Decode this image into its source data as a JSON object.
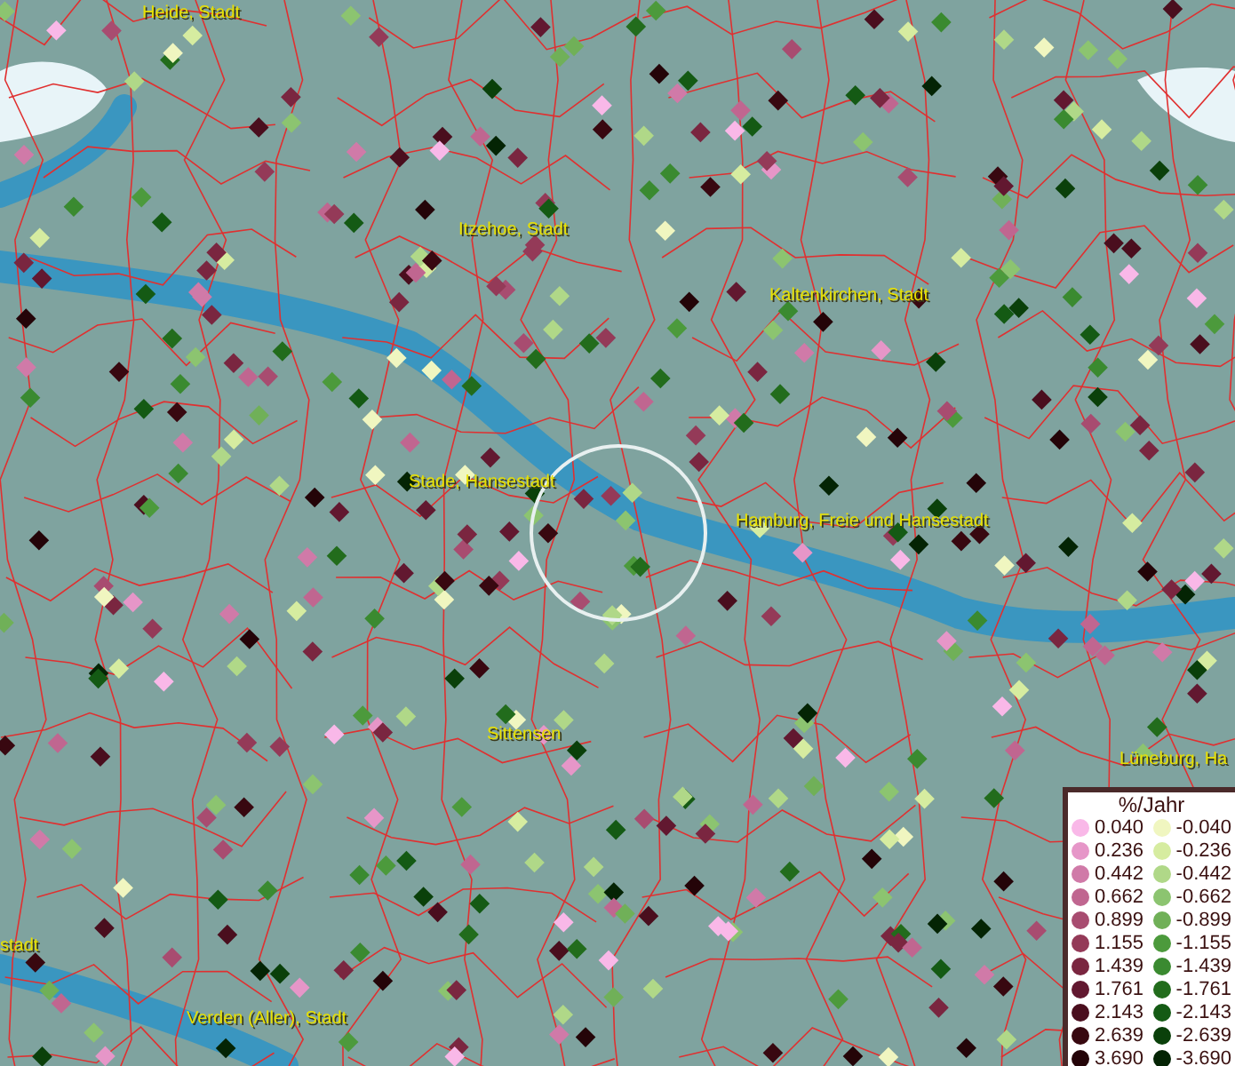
{
  "map_labels": [
    "Heide, Stadt",
    "Itzehoe, Stadt",
    "Kaltenkirchen, Stadt",
    "Stade, Hansestadt",
    "Hamburg, Freie und Hansestadt",
    "Sittensen",
    "Lüneburg, Ha",
    "stadt",
    "Verden (Aller), Stadt"
  ],
  "legend": {
    "title": "%/Jahr",
    "positive": [
      {
        "value": "0.040",
        "color": "#f9b8e8"
      },
      {
        "value": "0.236",
        "color": "#e696c8"
      },
      {
        "value": "0.442",
        "color": "#d07aa8"
      },
      {
        "value": "0.662",
        "color": "#c06690"
      },
      {
        "value": "0.899",
        "color": "#a84c70"
      },
      {
        "value": "1.155",
        "color": "#943a58"
      },
      {
        "value": "1.439",
        "color": "#7a2640"
      },
      {
        "value": "1.761",
        "color": "#621830"
      },
      {
        "value": "2.143",
        "color": "#4a0e1e"
      },
      {
        "value": "2.639",
        "color": "#380810"
      },
      {
        "value": "3.690",
        "color": "#240408"
      }
    ],
    "negative": [
      {
        "value": "-0.040",
        "color": "#f0f6c0"
      },
      {
        "value": "-0.236",
        "color": "#d6eca0"
      },
      {
        "value": "-0.442",
        "color": "#b0d888"
      },
      {
        "value": "-0.662",
        "color": "#8cc470"
      },
      {
        "value": "-0.899",
        "color": "#70b058"
      },
      {
        "value": "-1.155",
        "color": "#4c9a3c"
      },
      {
        "value": "-1.439",
        "color": "#3a8a30"
      },
      {
        "value": "-1.761",
        "color": "#226c1c"
      },
      {
        "value": "-2.143",
        "color": "#145a14"
      },
      {
        "value": "-2.639",
        "color": "#0a400a"
      },
      {
        "value": "-3.690",
        "color": "#042404"
      }
    ]
  }
}
